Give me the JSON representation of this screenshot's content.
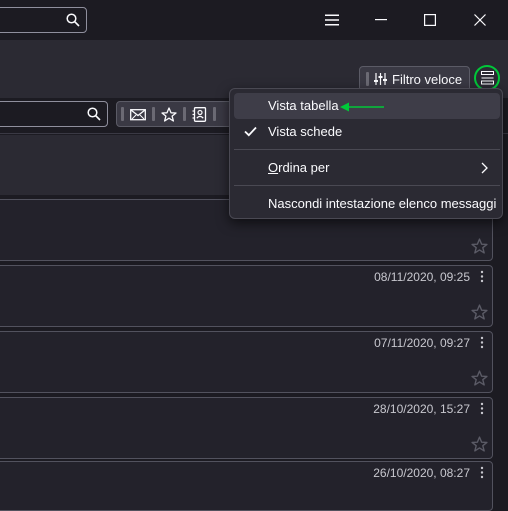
{
  "colors": {
    "accent_arrow": "#00c839",
    "background": "#1c1b22",
    "toolbar": "#2b2a33"
  },
  "titlebar": {
    "icons": [
      "search-icon",
      "hamburger-menu-icon",
      "minimize-icon",
      "maximize-icon",
      "close-icon"
    ]
  },
  "quick_filter": {
    "label": "Filtro veloce",
    "icons": [
      "sliders-icon",
      "list-layout-icon"
    ]
  },
  "filter_row": {
    "icons": [
      "search-icon",
      "unread-mail-icon",
      "star-icon",
      "contact-card-icon"
    ]
  },
  "menu": {
    "items": [
      {
        "label": "Vista tabella",
        "highlighted": true,
        "checked": false
      },
      {
        "label": "Vista schede",
        "highlighted": false,
        "checked": true
      },
      {
        "label_prefix": "O",
        "label_rest": "rdina per",
        "label": "Ordina per",
        "submenu": true
      },
      {
        "label": "Nascondi intestazione elenco messaggi"
      }
    ]
  },
  "messages": [
    {
      "date": ""
    },
    {
      "date": "08/11/2020, 09:25"
    },
    {
      "date": "07/11/2020, 09:27"
    },
    {
      "date": "28/10/2020, 15:27"
    },
    {
      "date": "26/10/2020, 08:27"
    }
  ]
}
